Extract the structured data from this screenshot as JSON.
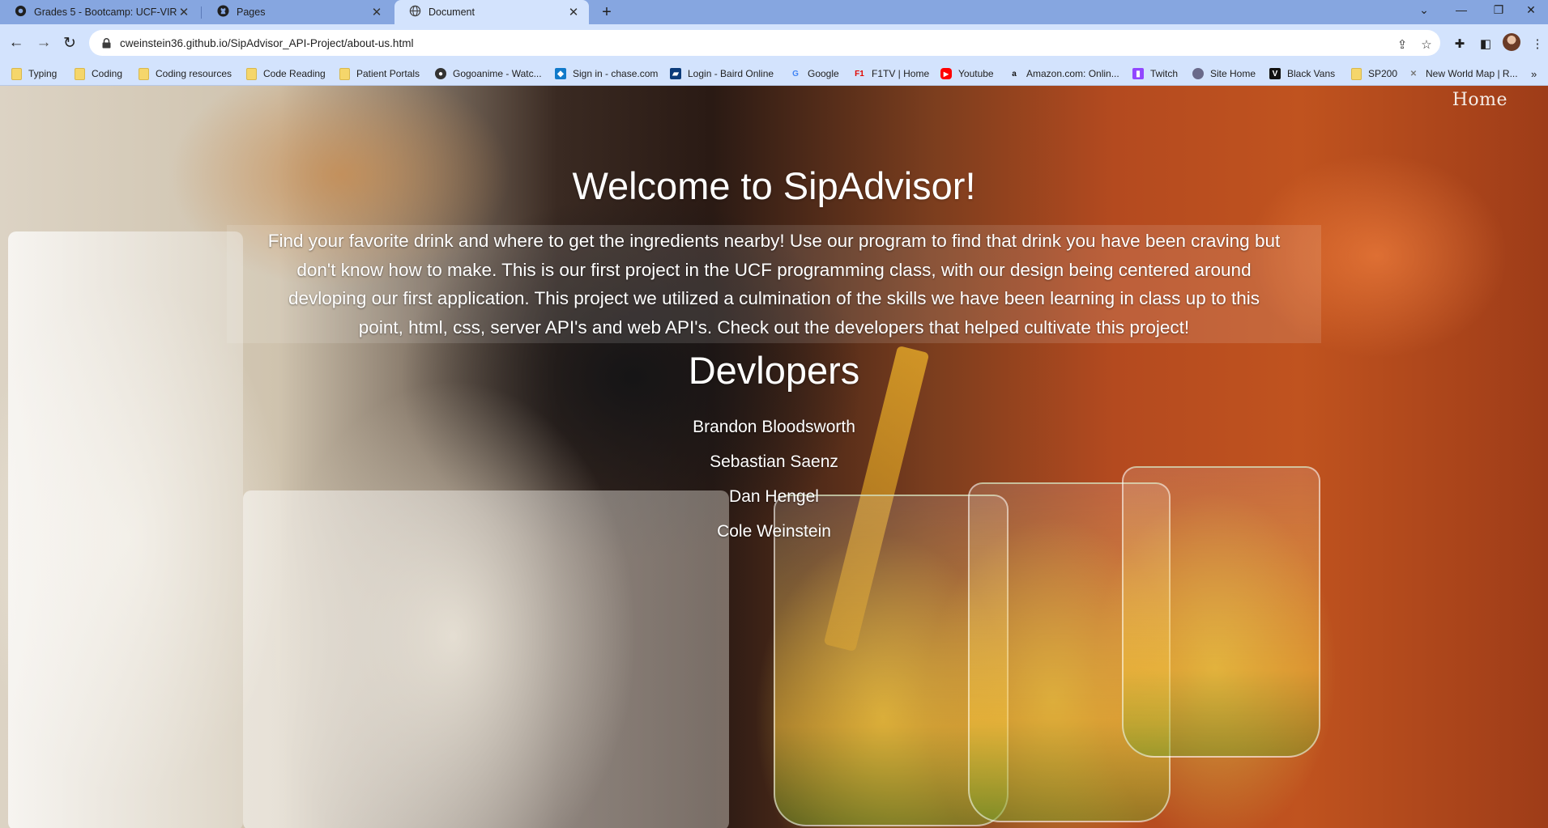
{
  "browser": {
    "tabs": [
      {
        "title": "Grades 5 - Bootcamp: UCF-VIRT",
        "icon": "canvas-icon",
        "active": false
      },
      {
        "title": "Pages",
        "icon": "github-icon",
        "active": false
      },
      {
        "title": "Document",
        "icon": "globe-icon",
        "active": true
      }
    ],
    "url": "cweinstein36.github.io/SipAdvisor_API-Project/about-us.html",
    "bookmarks": [
      {
        "label": "Typing",
        "icon": "folder-icon"
      },
      {
        "label": "Coding",
        "icon": "folder-icon"
      },
      {
        "label": "Coding resources",
        "icon": "folder-icon"
      },
      {
        "label": "Code Reading",
        "icon": "folder-icon"
      },
      {
        "label": "Patient Portals",
        "icon": "folder-icon"
      },
      {
        "label": "Gogoanime - Watc...",
        "icon": "gogoanime-icon"
      },
      {
        "label": "Sign in - chase.com",
        "icon": "chase-icon"
      },
      {
        "label": "Login - Baird Online",
        "icon": "baird-icon"
      },
      {
        "label": "Google",
        "icon": "google-icon"
      },
      {
        "label": "F1TV | Home",
        "icon": "f1-icon"
      },
      {
        "label": "Youtube",
        "icon": "youtube-icon"
      },
      {
        "label": "Amazon.com: Onlin...",
        "icon": "amazon-icon"
      },
      {
        "label": "Twitch",
        "icon": "twitch-icon"
      },
      {
        "label": "Site Home",
        "icon": "site-home-icon"
      },
      {
        "label": "Black Vans",
        "icon": "vans-icon"
      },
      {
        "label": "SP200",
        "icon": "folder-icon"
      },
      {
        "label": "New World Map | R...",
        "icon": "new-world-icon"
      }
    ],
    "bookmarks_more": "»"
  },
  "page": {
    "nav_home": "Home",
    "title": "Welcome to SipAdvisor!",
    "about_lines": [
      "Find your favorite drink and where to get the ingredients nearby! Use our program to find that drink you have been craving but",
      "don't know how to make. This is our first project in the UCF programming class, with our design being centered around",
      "devloping our first application. This project we utilized a culmination of the skills we have been learning in class up to this",
      "point, html, css, server API's and web API's. Check out the developers that helped cultivate this project!"
    ],
    "developers_title": "Devlopers",
    "developers": [
      "Brandon Bloodsworth",
      "Sebastian Saenz",
      "Dan Hengel",
      "Cole Weinstein"
    ]
  }
}
